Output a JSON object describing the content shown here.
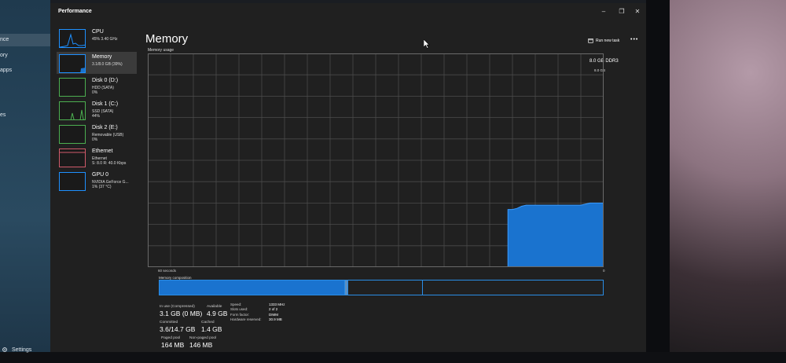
{
  "window": {
    "title": "Performance"
  },
  "left_app": {
    "nav": [
      "nce",
      "ory",
      "apps",
      "es"
    ],
    "settings_label": "Settings"
  },
  "sidebar": {
    "items": [
      {
        "name": "CPU",
        "line2": "45% 3.40 GHz",
        "line3": "",
        "color": "#1e90ff"
      },
      {
        "name": "Memory",
        "line2": "3.1/8.0 GB (39%)",
        "line3": "",
        "color": "#1e90ff"
      },
      {
        "name": "Disk 0 (D:)",
        "line2": "HDD (SATA)",
        "line3": "0%",
        "color": "#4caf50"
      },
      {
        "name": "Disk 1 (C:)",
        "line2": "SSD (SATA)",
        "line3": "44%",
        "color": "#4caf50"
      },
      {
        "name": "Disk 2 (E:)",
        "line2": "Removable (USB)",
        "line3": "0%",
        "color": "#4caf50"
      },
      {
        "name": "Ethernet",
        "line2": "Ethernet",
        "line3": "S: 8.0 R: 40.0 Kbps",
        "color": "#d05a6a"
      },
      {
        "name": "GPU 0",
        "line2": "NVIDIA GeForce G...",
        "line3": "1% (37 °C)",
        "color": "#1e90ff"
      }
    ]
  },
  "header": {
    "title": "Memory",
    "spec": "8.0 GB DDR3",
    "run_new_task": "Run new task",
    "more": "•••"
  },
  "graph": {
    "label": "Memory usage",
    "max_label": "8.0 GB",
    "x_left": "60 seconds",
    "x_right": "0",
    "color": "#1a73cf",
    "usage_series": [
      0,
      0,
      0,
      0,
      0,
      0,
      0,
      0,
      0,
      0,
      0,
      0,
      0,
      0,
      0,
      0,
      0,
      0,
      0,
      0,
      0,
      0,
      0,
      0,
      0,
      0,
      0,
      0,
      0,
      0,
      0,
      0,
      0,
      0,
      0,
      0,
      0,
      0,
      0,
      0,
      0,
      0,
      0,
      0,
      0,
      0,
      0,
      0,
      0,
      0,
      0,
      0,
      0,
      0,
      0,
      0,
      0,
      0,
      0,
      0,
      0,
      0,
      0,
      0,
      0,
      0,
      0,
      0,
      0,
      0,
      0,
      0,
      0,
      0,
      0,
      0,
      0,
      0,
      0,
      0.27,
      0.27,
      0.275,
      0.285,
      0.29,
      0.29,
      0.29,
      0.29,
      0.29,
      0.29,
      0.29,
      0.29,
      0.29,
      0.29,
      0.29,
      0.29,
      0.29,
      0.295,
      0.3,
      0.3,
      0.3,
      0.3
    ]
  },
  "composition": {
    "label": "Memory composition",
    "in_use": 0.416,
    "modified": 0.004,
    "standby": 0.17
  },
  "stats": {
    "in_use_label": "In use (Compressed)",
    "in_use_value": "3.1 GB (0 MB)",
    "available_label": "Available",
    "available_value": "4.9 GB",
    "committed_label": "Committed",
    "committed_value": "3.6/14.7 GB",
    "cached_label": "Cached",
    "cached_value": "1.4 GB",
    "paged_label": "Paged pool",
    "paged_value": "164 MB",
    "nonpaged_label": "Non-paged pool",
    "nonpaged_value": "146 MB"
  },
  "properties": {
    "labels": [
      "Speed:",
      "Slots used:",
      "Form factor:",
      "Hardware reserved:"
    ],
    "values": [
      "1333 MHz",
      "2 of 2",
      "DIMM",
      "30.9 MB"
    ]
  }
}
